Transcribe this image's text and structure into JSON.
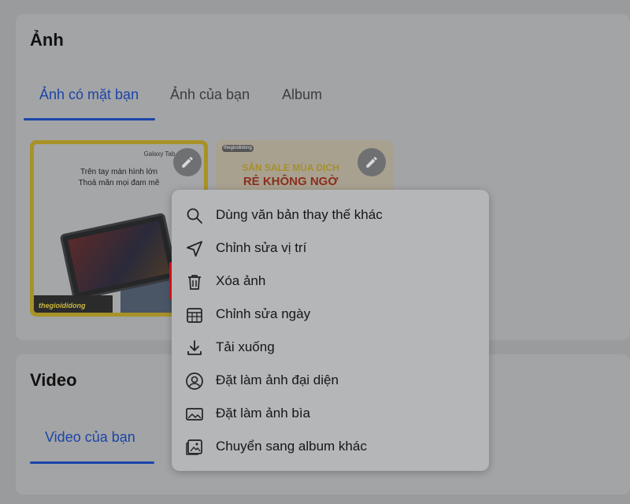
{
  "photos": {
    "title": "Ảnh",
    "tabs": [
      {
        "label": "Ảnh có mặt bạn",
        "active": true
      },
      {
        "label": "Ảnh của bạn",
        "active": false
      },
      {
        "label": "Album",
        "active": false
      }
    ],
    "thumbnails": [
      {
        "brand": "Galaxy Tab A7 Lite",
        "line1": "Trên tay màn hình lớn",
        "line2": "Thoả mãn mọi đam mê",
        "logo": "thegioididong"
      },
      {
        "logo": "thegioididong",
        "line1": "SĂN SALE MÙA DỊCH",
        "line2": "RẺ KHÔNG NGỜ"
      }
    ]
  },
  "video": {
    "title": "Video",
    "tabs": [
      {
        "label": "Video của bạn",
        "active": true
      }
    ]
  },
  "context_menu": {
    "items": [
      {
        "label": "Dùng văn bản thay thế khác",
        "icon": "search-icon"
      },
      {
        "label": "Chỉnh sửa vị trí",
        "icon": "location-arrow-icon"
      },
      {
        "label": "Xóa ảnh",
        "icon": "trash-icon",
        "highlighted": true
      },
      {
        "label": "Chỉnh sửa ngày",
        "icon": "calendar-icon"
      },
      {
        "label": "Tải xuống",
        "icon": "download-icon"
      },
      {
        "label": "Đặt làm ảnh đại diện",
        "icon": "profile-icon"
      },
      {
        "label": "Đặt làm ảnh bìa",
        "icon": "image-icon"
      },
      {
        "label": "Chuyển sang album khác",
        "icon": "album-move-icon"
      }
    ]
  },
  "colors": {
    "accent": "#1b45a8",
    "highlight_border": "#e0141d"
  }
}
